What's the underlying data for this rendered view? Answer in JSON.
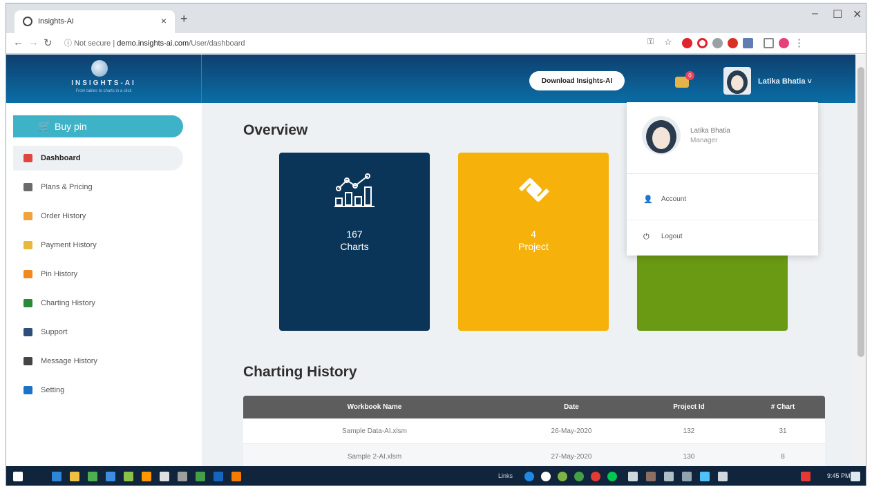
{
  "browser": {
    "tab_title": "Insights-AI",
    "tab_close": "×",
    "new_tab": "+",
    "url_prefix": "Not secure",
    "url_host": "demo.insights-ai.com",
    "url_path": "/User/dashboard",
    "minimize": "–",
    "maximize": "☐",
    "close": "✕"
  },
  "header": {
    "logo_text": "INSIGHTS-AI",
    "logo_tagline": "From tables to charts in a click",
    "download_button": "Download Insights-AI",
    "notification_count": "0",
    "user_name": "Latika Bhatia ˅"
  },
  "sidebar": {
    "buy_pin": "Buy pin",
    "items": [
      {
        "label": "Dashboard",
        "color": "#e0453f"
      },
      {
        "label": "Plans & Pricing",
        "color": "#6b6b6b"
      },
      {
        "label": "Order History",
        "color": "#f0a33a"
      },
      {
        "label": "Payment History",
        "color": "#e8b83b"
      },
      {
        "label": "Pin History",
        "color": "#f08a1e"
      },
      {
        "label": "Charting History",
        "color": "#2a8a3a"
      },
      {
        "label": "Support",
        "color": "#2f4d7a"
      },
      {
        "label": "Message History",
        "color": "#444444"
      },
      {
        "label": "Setting",
        "color": "#1a73c9"
      }
    ]
  },
  "main": {
    "overview_title": "Overview",
    "cards": [
      {
        "number": "167",
        "label": "Charts",
        "color": "#0b3558"
      },
      {
        "number": "4",
        "label": "Project",
        "color": "#f6b20b"
      },
      {
        "number": "",
        "label": "",
        "color": "#6a9a14"
      }
    ],
    "history_title": "Charting History",
    "table": {
      "headers": [
        "Workbook Name",
        "Date",
        "Project Id",
        "# Chart"
      ],
      "rows": [
        [
          "Sample Data-AI.xlsm",
          "26-May-2020",
          "132",
          "31"
        ],
        [
          "Sample 2-AI.xlsm",
          "27-May-2020",
          "130",
          "8"
        ]
      ]
    }
  },
  "dropdown": {
    "name": "Latika Bhatia",
    "role": "Manager",
    "account": "Account",
    "logout": "Logout"
  },
  "taskbar": {
    "links": "Links",
    "clock": "9:45 PM"
  }
}
